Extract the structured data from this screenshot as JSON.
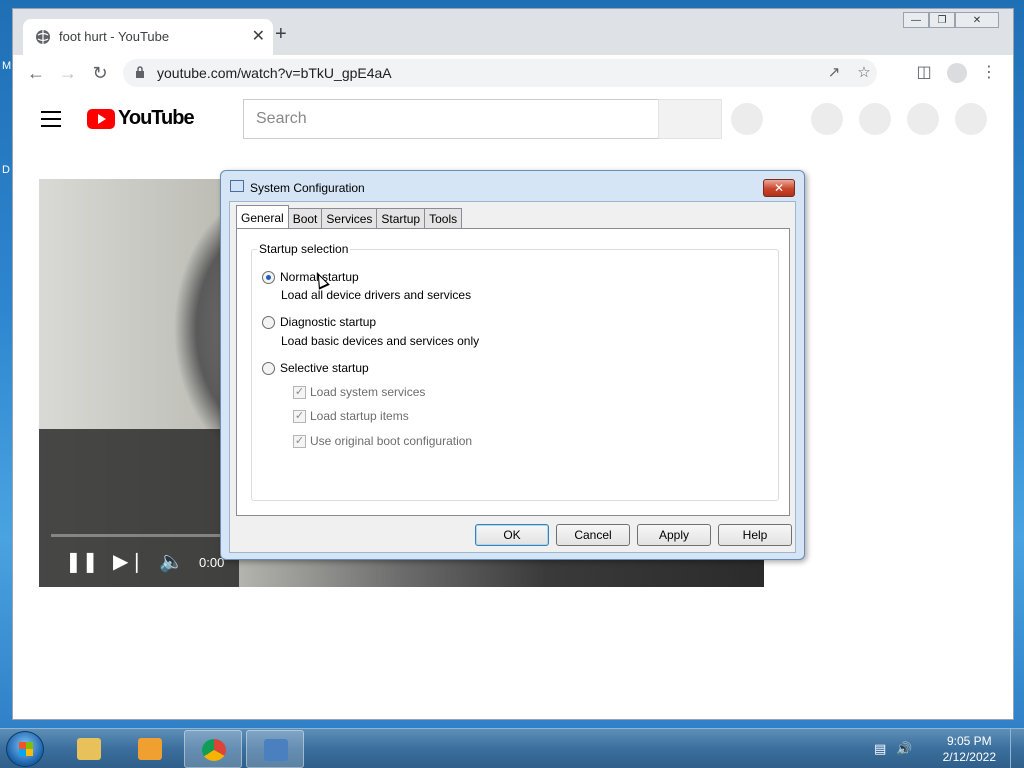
{
  "desktop": {
    "letters": [
      "M",
      "D"
    ]
  },
  "browser": {
    "tab_title": "foot hurt - YouTube",
    "tab_close": "✕",
    "new_tab": "+",
    "url": "youtube.com/watch?v=bTkU_gpE4aA",
    "window_controls": {
      "minimize": "—",
      "maximize": "❐",
      "close": "✕"
    }
  },
  "youtube": {
    "logo_text": "YouTube",
    "search_placeholder": "Search",
    "player": {
      "time": "0:00"
    }
  },
  "dialog": {
    "title": "System Configuration",
    "close": "✕",
    "tabs": [
      "General",
      "Boot",
      "Services",
      "Startup",
      "Tools"
    ],
    "active_tab": "General",
    "group_label": "Startup selection",
    "options": [
      {
        "label": "Normal startup",
        "desc": "Load all device drivers and services",
        "selected": true
      },
      {
        "label": "Diagnostic startup",
        "desc": "Load basic devices and services only",
        "selected": false
      },
      {
        "label": "Selective startup",
        "desc": "",
        "selected": false
      }
    ],
    "selective_items": [
      {
        "label": "Load system services",
        "checked": true
      },
      {
        "label": "Load startup items",
        "checked": true
      },
      {
        "label": "Use original boot configuration",
        "checked": true
      }
    ],
    "buttons": {
      "ok": "OK",
      "cancel": "Cancel",
      "apply": "Apply",
      "help": "Help"
    }
  },
  "taskbar": {
    "time": "9:05 PM",
    "date": "2/12/2022",
    "colors": {
      "explorer": "#e8c15a",
      "media": "#f0a030",
      "chrome": "#db4437",
      "msconfig": "#4a7fc0"
    }
  }
}
